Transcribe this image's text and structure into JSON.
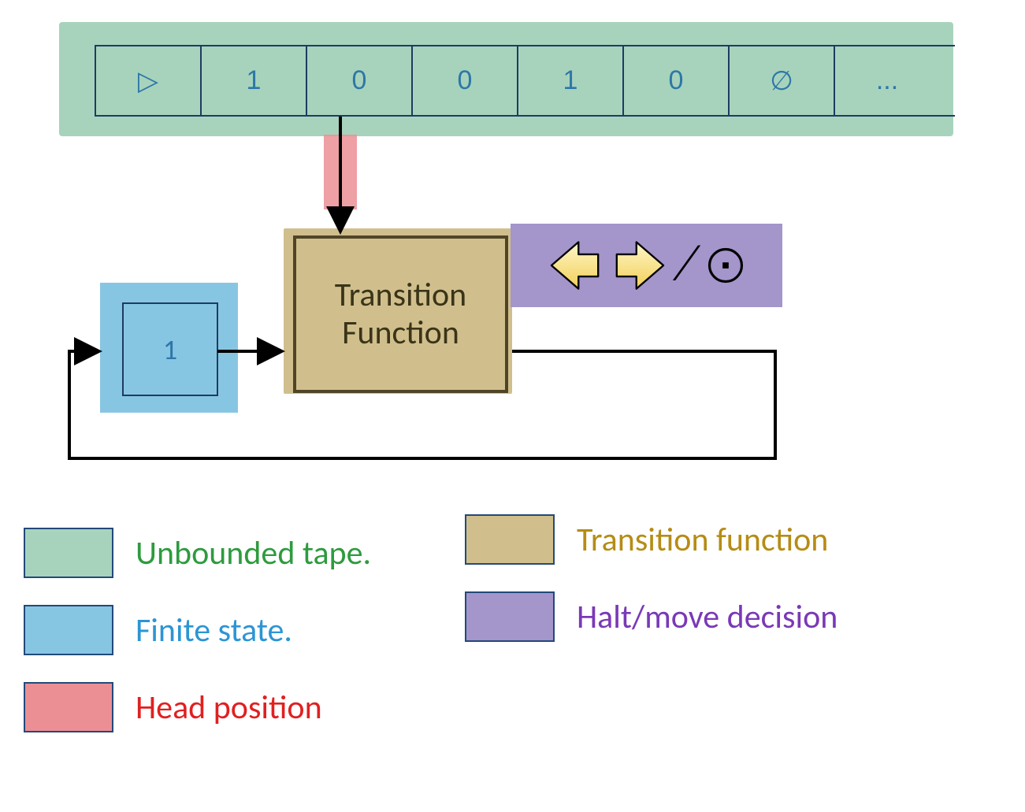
{
  "tape": {
    "cells": [
      "▷",
      "1",
      "0",
      "0",
      "1",
      "0",
      "∅",
      "..."
    ]
  },
  "head": {
    "position_index": 2
  },
  "transition": {
    "label_line1": "Transition",
    "label_line2": "Function"
  },
  "state": {
    "value": "1"
  },
  "halt_move": {
    "left_icon": "left-arrow-icon",
    "right_icon": "right-arrow-icon",
    "separator": "⁄",
    "halt_icon": "halt-dot-icon"
  },
  "legend": {
    "tape": "Unbounded tape.",
    "state": "Finite state.",
    "head": "Head position",
    "transition": "Transition function",
    "halt": "Halt/move decision"
  },
  "colors": {
    "tape_bg": "#a7d3bd",
    "state_bg": "#87c6e3",
    "head_bg": "#eb8f95",
    "transition_bg": "#d0bf8d",
    "halt_bg": "#a495cb",
    "cell_text": "#2e77a7",
    "border_dark": "#1f3b60"
  }
}
